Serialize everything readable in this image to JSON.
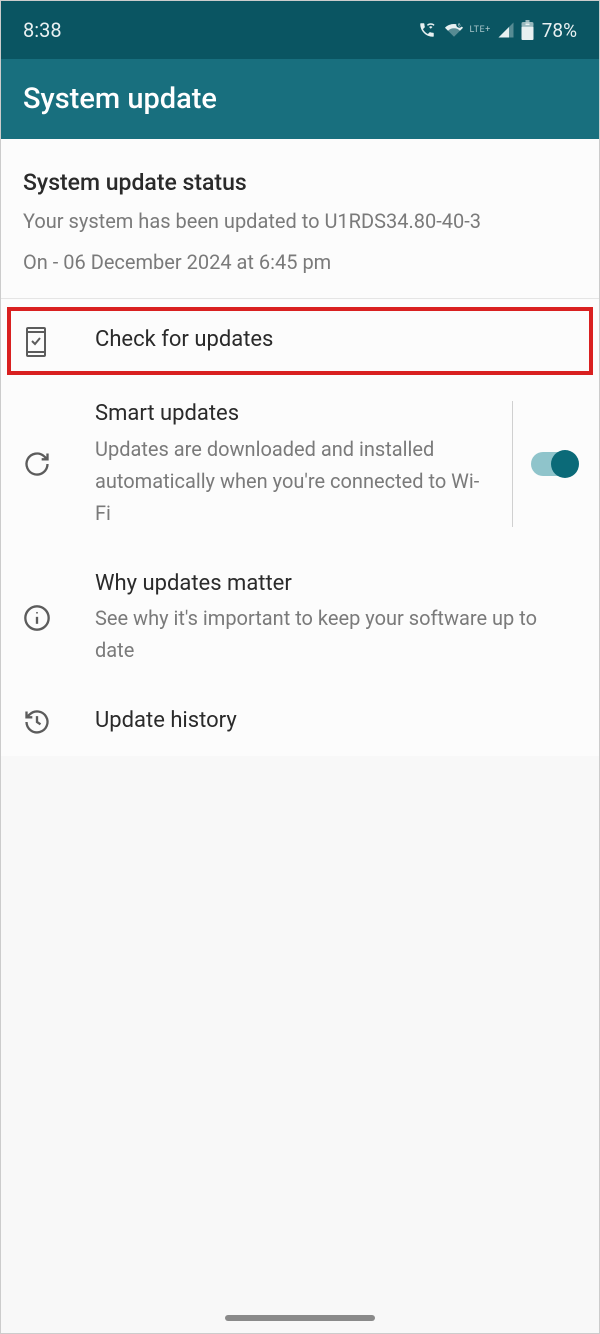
{
  "statusbar": {
    "time": "8:38",
    "lte": "LTE+",
    "battery": "78%"
  },
  "header": {
    "title": "System update"
  },
  "statusSection": {
    "heading": "System update status",
    "description": "Your system has been updated to U1RDS34.80-40-3",
    "date": "On - 06 December 2024 at 6:45 pm"
  },
  "items": {
    "checkUpdates": {
      "title": "Check for updates"
    },
    "smartUpdates": {
      "title": "Smart updates",
      "subtitle": "Updates are downloaded and installed automatically when you're connected to Wi-Fi",
      "toggle": true
    },
    "whyMatter": {
      "title": "Why updates matter",
      "subtitle": "See why it's important to keep your software up to date"
    },
    "history": {
      "title": "Update history"
    }
  }
}
